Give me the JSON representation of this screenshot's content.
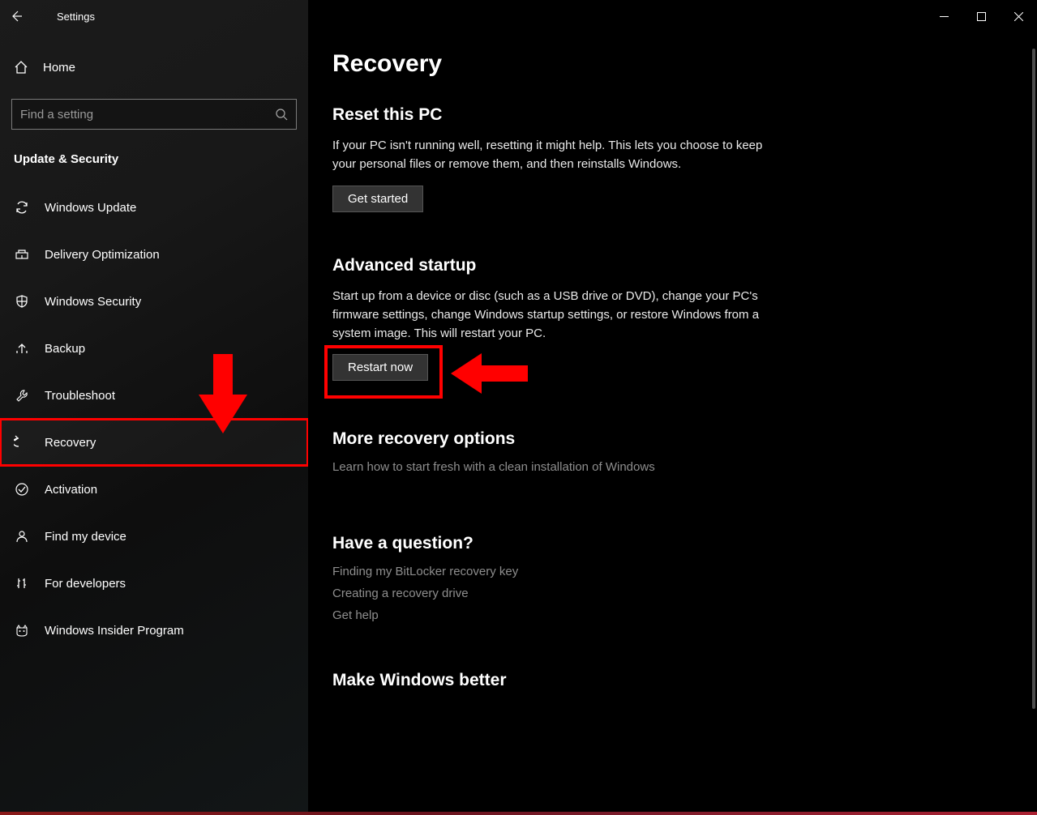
{
  "titlebar": {
    "title": "Settings"
  },
  "sidebar": {
    "home_label": "Home",
    "search_placeholder": "Find a setting",
    "section_title": "Update & Security",
    "items": [
      {
        "label": "Windows Update"
      },
      {
        "label": "Delivery Optimization"
      },
      {
        "label": "Windows Security"
      },
      {
        "label": "Backup"
      },
      {
        "label": "Troubleshoot"
      },
      {
        "label": "Recovery"
      },
      {
        "label": "Activation"
      },
      {
        "label": "Find my device"
      },
      {
        "label": "For developers"
      },
      {
        "label": "Windows Insider Program"
      }
    ]
  },
  "main": {
    "title": "Recovery",
    "reset": {
      "heading": "Reset this PC",
      "body": "If your PC isn't running well, resetting it might help. This lets you choose to keep your personal files or remove them, and then reinstalls Windows.",
      "button": "Get started"
    },
    "advanced": {
      "heading": "Advanced startup",
      "body": "Start up from a device or disc (such as a USB drive or DVD), change your PC's firmware settings, change Windows startup settings, or restore Windows from a system image. This will restart your PC.",
      "button": "Restart now"
    },
    "more": {
      "heading": "More recovery options",
      "link": "Learn how to start fresh with a clean installation of Windows"
    },
    "question": {
      "heading": "Have a question?",
      "links": [
        "Finding my BitLocker recovery key",
        "Creating a recovery drive",
        "Get help"
      ]
    },
    "better": {
      "heading": "Make Windows better"
    }
  },
  "annotation": {
    "color": "#ff0000"
  }
}
